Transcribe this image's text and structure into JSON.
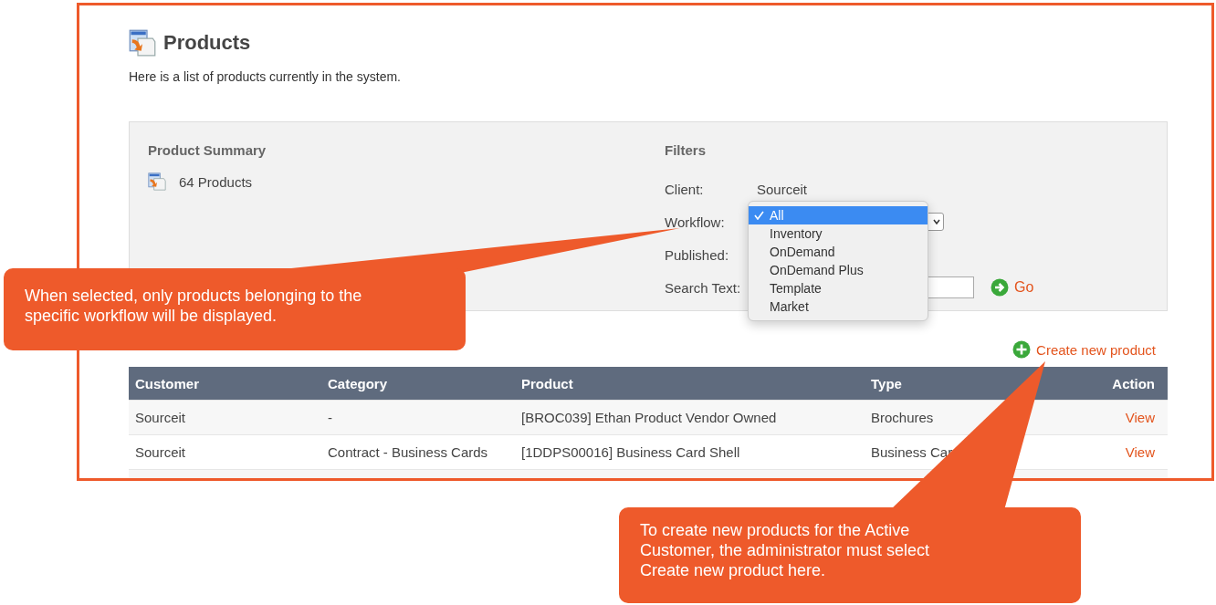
{
  "page": {
    "title": "Products",
    "description": "Here is a list of products currently in the system."
  },
  "summary": {
    "heading": "Product Summary",
    "count": "64 Products"
  },
  "filters": {
    "heading": "Filters",
    "fields": [
      {
        "kind": "text",
        "label": "Client:",
        "value": "Sourceit"
      },
      {
        "kind": "select",
        "label": "Workflow:"
      },
      {
        "kind": "covered",
        "label": "Published:"
      },
      {
        "kind": "search",
        "label": "Search Text:",
        "button": "Go"
      }
    ]
  },
  "workflow_menu": {
    "options": [
      {
        "label": "All",
        "selected": true
      },
      {
        "label": "Inventory",
        "selected": false
      },
      {
        "label": "OnDemand",
        "selected": false
      },
      {
        "label": "OnDemand Plus",
        "selected": false
      },
      {
        "label": "Template",
        "selected": false
      },
      {
        "label": "Market",
        "selected": false
      }
    ]
  },
  "create_link": "Create new product",
  "table": {
    "columns": [
      "Customer",
      "Category",
      "Product",
      "Type",
      "Action"
    ],
    "rows": [
      {
        "cells": [
          "Sourceit",
          "-",
          "[BROC039] Ethan Product Vendor Owned",
          "Brochures"
        ],
        "action": "View"
      },
      {
        "cells": [
          "Sourceit",
          "Contract - Business Cards",
          "[1DDPS00016] Business Card Shell",
          "Business Car"
        ],
        "action": "View"
      }
    ]
  },
  "callouts": [
    {
      "text": "When selected, only products belonging to the specific workflow will be displayed."
    },
    {
      "text": "To create new products for the Active Customer, the administrator must select Create new product here."
    }
  ]
}
